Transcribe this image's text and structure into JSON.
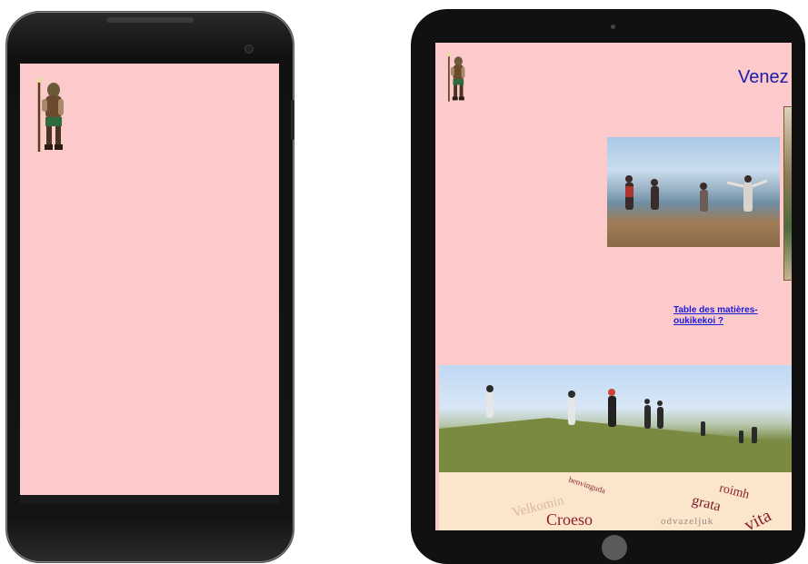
{
  "tablet": {
    "title": "Venez",
    "toc_link": "Table des matières-oukikekoi ?",
    "welcome_words": [
      "benvinguda",
      "Velkomin",
      "Croeso",
      "roimh",
      "grata",
      "vita",
      "odvazeljuk"
    ]
  },
  "colors": {
    "page_background": "#fccaca",
    "title": "#1a1aa6",
    "link": "#1a1ad8",
    "device_frame": "#111111"
  },
  "icons": [
    "hiker-mascot-icon"
  ]
}
